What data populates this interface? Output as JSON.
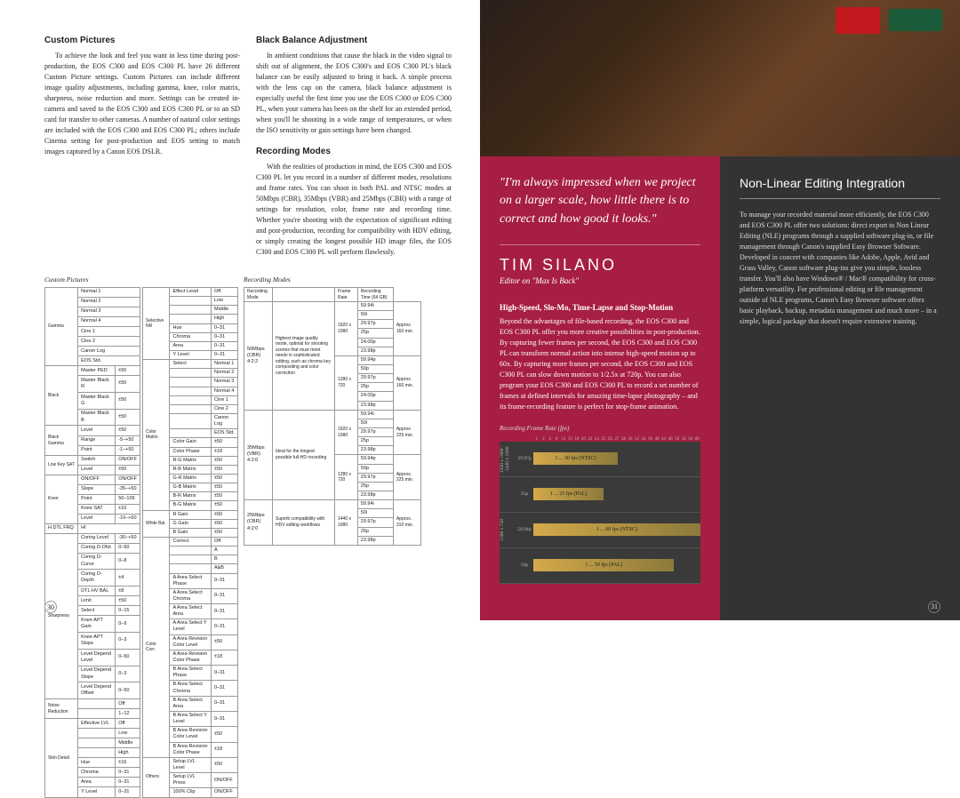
{
  "left": {
    "custom": {
      "h": "Custom Pictures",
      "p": "To achieve the look and feel you want in less time during post-production, the EOS C300 and EOS C300 PL have 26 different Custom Picture settings. Custom Pictures can include different image quality adjustments, including gamma, knee, color matrix, sharpness, noise reduction and more. Settings can be created in-camera and saved to the EOS C300 and EOS C300 PL or to an SD card for transfer to other cameras. A number of natural color settings are included with the EOS C300 and EOS C300 PL; others include Cinema setting for post-production and EOS setting to match images captured by a Canon EOS DSLR."
    },
    "black": {
      "h": "Black Balance Adjustment",
      "p": "In ambient conditions that cause the black in the video signal to shift out of alignment, the EOS C300's and EOS C300 PL's black balance can be easily adjusted to bring it back. A simple process with the lens cap on the camera, black balance adjustment is especially useful the first time you use the EOS C300 or EOS C300 PL, when your camera has been on the shelf for an extended period, when you'll be shooting in a wide range of temperatures, or when the ISO sensitivity or gain settings have been changed."
    },
    "rec": {
      "h": "Recording Modes",
      "p": "With the realities of production in mind, the EOS C300 and EOS C300 PL let you record in a number of different modes, resolutions and frame rates. You can shoot in both PAL and NTSC modes at 50Mbps (CBR), 35Mbps (VBR) and 25Mbps (CBR) with a range of settings for resolution, color, frame rate and recording time. Whether you're shooting with the expectation of significant editing and post-production, recording for compatibility with HDV editing, or simply creating the longest possible HD image files, the EOS C300 and EOS C300 PL will perform flawlessly."
    },
    "tbl1_title": "Custom Pictures",
    "tbl2_title": "Recording Modes",
    "page": "30"
  },
  "tbl1": {
    "gamma": {
      "label": "Gamma",
      "rows": [
        "Normal 1",
        "Normal 2",
        "Normal 3",
        "Normal 4",
        "Cine 1",
        "Cine 2",
        "Canon Log",
        "EOS Std."
      ]
    },
    "black": {
      "label": "Black",
      "rows": [
        [
          "Master PED",
          "±50"
        ],
        [
          "Master Black R",
          "±50"
        ],
        [
          "Master Black G",
          "±50"
        ],
        [
          "Master Black B",
          "±50"
        ]
      ]
    },
    "blackgamma": {
      "label": "Black Gamma",
      "rows": [
        [
          "Level",
          "±50"
        ],
        [
          "Range",
          "-5–+50"
        ],
        [
          "Point",
          "-1–+50"
        ]
      ]
    },
    "lowkey": {
      "label": "Low Key SAT",
      "rows": [
        [
          "Switch",
          "ON/OFF"
        ],
        [
          "Level",
          "±50"
        ]
      ]
    },
    "knee": {
      "label": "Knee",
      "rows": [
        [
          "ON/OFF",
          "ON/OFF"
        ],
        [
          "Slope",
          "-35–+50"
        ],
        [
          "Point",
          "50–109"
        ],
        [
          "Knee SAT",
          "±10"
        ],
        [
          "Level",
          "-10–+50"
        ]
      ]
    },
    "hdtl": {
      "label": "H DTL FRQ",
      "val": "HI"
    },
    "sharpness": {
      "label": "Sharpness",
      "rows": [
        [
          "Coring Level",
          "-30–+50"
        ],
        [
          "Coring D-Ofst",
          "0–50"
        ],
        [
          "Coring D-Curve",
          "0–8"
        ],
        [
          "Coring D-Depth",
          "±4"
        ],
        [
          "DTL HV BAL",
          "±8"
        ],
        [
          "Limit",
          "±50"
        ],
        [
          "Select",
          "0–15"
        ],
        [
          "Knee APT Gain",
          "0–9"
        ],
        [
          "Knee APT Slope",
          "0–3"
        ],
        [
          "Level Depend Level",
          "0–50"
        ],
        [
          "Level Depend Slope",
          "0–3"
        ],
        [
          "Level Depend Offset",
          "0–50"
        ]
      ]
    },
    "nr": {
      "label": "Noise Reduction",
      "rows": [
        [
          "",
          "Off"
        ],
        [
          "",
          "1–12"
        ]
      ]
    },
    "skin": {
      "label": "Skin Detail",
      "rows": [
        [
          "Effective LVL",
          "Off"
        ],
        [
          "",
          "Low"
        ],
        [
          "",
          "Middle"
        ],
        [
          "",
          "High"
        ],
        [
          "Hue",
          "±16"
        ],
        [
          "Chroma",
          "0–31"
        ],
        [
          "Area",
          "0–31"
        ],
        [
          "Y Level",
          "0–31"
        ]
      ]
    },
    "selnr": {
      "label": "Selective NR",
      "rows": [
        [
          "Effect Level",
          "Off"
        ],
        [
          "",
          "Low"
        ],
        [
          "",
          "Middle"
        ],
        [
          "",
          "High"
        ],
        [
          "Hue",
          "0–31"
        ],
        [
          "Chroma",
          "0–31"
        ],
        [
          "Area",
          "0–31"
        ],
        [
          "Y Level",
          "0–31"
        ]
      ]
    },
    "colormatrix": {
      "label": "Color Matrix",
      "rows": [
        [
          "Select",
          "Normal 1"
        ],
        [
          "",
          "Normal 2"
        ],
        [
          "",
          "Normal 3"
        ],
        [
          "",
          "Normal 4"
        ],
        [
          "",
          "Cine 1"
        ],
        [
          "",
          "Cine 2"
        ],
        [
          "",
          "Canon Log"
        ],
        [
          "",
          "EOS Std."
        ],
        [
          "Color Gain",
          "±50"
        ],
        [
          "Color Phase",
          "±18"
        ],
        [
          "R-G Matrix",
          "±50"
        ],
        [
          "R-B Matrix",
          "±50"
        ],
        [
          "G-R Matrix",
          "±50"
        ],
        [
          "G-B Matrix",
          "±50"
        ],
        [
          "B-R Matrix",
          "±50"
        ],
        [
          "B-G Matrix",
          "±50"
        ]
      ]
    },
    "whitebal": {
      "label": "White Bal.",
      "rows": [
        [
          "R Gain",
          "±50"
        ],
        [
          "G Gain",
          "±50"
        ],
        [
          "B Gain",
          "±50"
        ]
      ]
    },
    "colorcorr": {
      "label": "Color Corr.",
      "rows": [
        [
          "Correct",
          "Off"
        ],
        [
          "",
          "A"
        ],
        [
          "",
          "B"
        ],
        [
          "",
          "A&B"
        ],
        [
          "A Area Select Phase",
          "0–31"
        ],
        [
          "A Area Select Chroma",
          "0–31"
        ],
        [
          "A Area Select Area",
          "0–31"
        ],
        [
          "A Area Select Y Level",
          "0–31"
        ],
        [
          "A Area Revision Color Level",
          "±50"
        ],
        [
          "A Area Revision Color Phase",
          "±18"
        ],
        [
          "B Area Select Phase",
          "0–31"
        ],
        [
          "B Area Select Chroma",
          "0–31"
        ],
        [
          "B Area Select Area",
          "0–31"
        ],
        [
          "B Area Select Y Level",
          "0–31"
        ],
        [
          "B Area Revision Color Level",
          "±50"
        ],
        [
          "B Area Revision Color Phase",
          "±18"
        ]
      ]
    },
    "others": {
      "label": "Others",
      "rows": [
        [
          "Setup LVL Level",
          "±50"
        ],
        [
          "Setup LVL Press",
          "ON/OFF"
        ],
        [
          "100% Clip",
          "ON/OFF"
        ]
      ]
    }
  },
  "tbl2": {
    "headers": [
      "Recording Mode",
      "",
      "Frame Rate",
      "Recording Time (64 GB)"
    ],
    "modes": [
      {
        "mode": "50Mbps (CBR) 4:2:2",
        "desc": "Highest image quality mode, optimal for shooting scenes that must meet needs in sophisticated editing, such as chroma key compositing and color correction",
        "res": [
          {
            "r": "1920 x 1080",
            "rates": [
              "59.94i",
              "50i",
              "29.97p",
              "25p",
              "24.00p",
              "23.98p"
            ],
            "time": "Approx. 160 min."
          },
          {
            "r": "1280 x 720",
            "rates": [
              "59.94p",
              "50p",
              "29.97p",
              "25p",
              "24.00p",
              "23.98p"
            ],
            "time": "Approx. 160 min."
          }
        ]
      },
      {
        "mode": "35Mbps (VBR) 4:2:0",
        "desc": "Ideal for the longest possible full-HD recording",
        "res": [
          {
            "r": "1920 x 1080",
            "rates": [
              "59.94i",
              "50i",
              "29.97p",
              "25p",
              "23.98p"
            ],
            "time": "Approx. 225 min."
          },
          {
            "r": "1280 x 720",
            "rates": [
              "59.94p",
              "50p",
              "29.97p",
              "25p",
              "23.98p"
            ],
            "time": "Approx. 225 min."
          }
        ]
      },
      {
        "mode": "25Mbps (CBR) 4:2:0",
        "desc": "Superb compatibility with HDV editing workflows",
        "res": [
          {
            "r": "1440 x 1080",
            "rates": [
              "59.94i",
              "50i",
              "29.97p",
              "25p",
              "23.98p"
            ],
            "time": "Approx. 310 min."
          }
        ]
      }
    ]
  },
  "quote": {
    "text": "\"I'm always impressed when we project on a larger scale, how little there is to correct and how good it looks.\"",
    "author": "TIM SILANO",
    "sub": "Editor on \"Max Is Back\""
  },
  "hispeed": {
    "h": "High-Speed, Slo-Mo, Time-Lapse and Stop-Motion",
    "p": "Beyond the advantages of file-based recording, the EOS C300 and EOS C300 PL offer you more creative possibilities in post-production. By capturing fewer frames per second, the EOS C300 and EOS C300 PL can transform normal action into intense high-speed motion up to 60x. By capturing more frames per second, the EOS C300 and EOS C300 PL can slow down motion to 1/2.5x at 720p. You can also program your EOS C300 and EOS C300 PL to record a set number of frames at defined intervals for amazing time-lapse photography – and its frame-recording feature is perfect for stop-frame animation."
  },
  "chart_title": "Recording Frame Rate (fps)",
  "chart_data": {
    "type": "bar",
    "xlabel": "fps",
    "ylabel": "",
    "xticks": [
      1,
      5,
      6,
      8,
      12,
      15,
      18,
      20,
      22,
      24,
      25,
      26,
      27,
      28,
      30,
      32,
      34,
      36,
      40,
      44,
      48,
      50,
      54,
      58,
      60
    ],
    "series": [
      {
        "group": "1920 x 1080 / 1440 x 1080",
        "sub": "29.97p",
        "label": "1 ... 30 fps (NTSC)",
        "range": [
          1,
          30
        ]
      },
      {
        "group": "1920 x 1080 / 1440 x 1080",
        "sub": "25p",
        "label": "1 ... 25 fps (PAL)",
        "range": [
          1,
          25
        ]
      },
      {
        "group": "1280 x 720",
        "sub": "59.94p",
        "label": "1 ... 60 fps (NTSC)",
        "range": [
          1,
          60
        ]
      },
      {
        "group": "1280 x 720",
        "sub": "50p",
        "label": "1 ... 50 fps (PAL)",
        "range": [
          1,
          50
        ]
      }
    ]
  },
  "nle": {
    "h": "Non-Linear Editing Integration",
    "p": "To manage your recorded material more efficiently, the EOS C300 and EOS C300 PL offer two solutions: direct export to Non Linear Editing (NLE) programs through a supplied software plug-in, or file management through Canon's supplied Easy Browser Software. Developed in concert with companies like Adobe, Apple, Avid and Grass Valley, Canon software plug-ins give you simple, lossless transfer. You'll also have Windows® / Mac® compatibility for cross-platform versatility. For professional editing or file management outside of NLE programs, Canon's Easy Browser software offers basic playback, backup, metadata management and much more – in a simple, logical package that doesn't require extensive training.",
    "page": "31"
  }
}
